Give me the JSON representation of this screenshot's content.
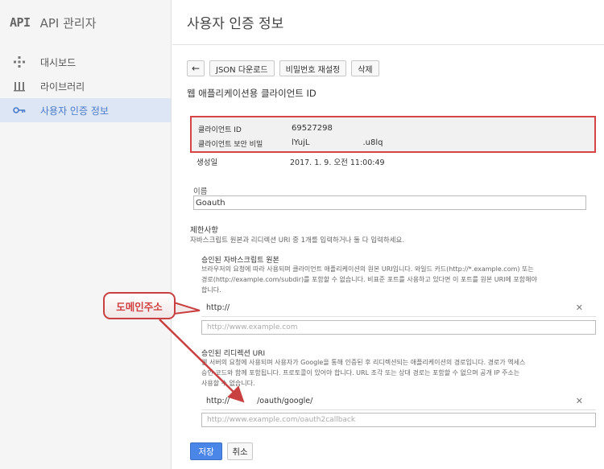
{
  "brand": {
    "logo": "API",
    "title": "API 관리자"
  },
  "sidebar": {
    "items": [
      {
        "label": "대시보드",
        "icon": "dashboard-icon"
      },
      {
        "label": "라이브러리",
        "icon": "library-icon"
      },
      {
        "label": "사용자 인증 정보",
        "icon": "key-icon"
      }
    ]
  },
  "header": {
    "title": "사용자 인증 정보"
  },
  "toolbar": {
    "back_label": "←",
    "download_label": "JSON 다운로드",
    "reset_label": "비밀번호 재설정",
    "delete_label": "삭제"
  },
  "section": {
    "title": "웹 애플리케이션용 클라이언트 ID"
  },
  "client": {
    "id_label": "클라이언트 ID",
    "id_value": "69527298",
    "secret_label": "클라이언트 보안 비밀",
    "secret_value_start": "lYujL",
    "secret_value_end": ".u8lq",
    "created_label": "생성일",
    "created_value": "2017. 1. 9. 오전 11:00:49"
  },
  "name_field": {
    "label": "이름",
    "value": "Goauth"
  },
  "restrictions": {
    "title": "제한사항",
    "desc": "자바스크립트 원본과 리디렉션 URI 중 1개를 입력하거나 둘 다 입력하세요.",
    "js_origins": {
      "title": "승인된 자바스크립트 원본",
      "desc_line1": "브라우저의 요청에 따라 사용되며 클라이언트 애플리케이션의 원본 URI입니다. 와일드 카드(http://*.example.com) 또는",
      "desc_line2": "경로(http://example.com/subdir)를 포함할 수 없습니다. 비표준 포트를 사용하고 있다면 이 포트를 원본 URI에 포함해야",
      "desc_line3": "합니다.",
      "entry": "http://",
      "placeholder": "http://www.example.com"
    },
    "redirect_uris": {
      "title": "승인된 리디렉션 URI",
      "desc_line1": "웹 서버의 요청에 사용되며 사용자가 Google을 통해 인증된 후 리디렉션되는 애플리케이션의 경로입니다. 경로가 액세스",
      "desc_line2": "승인 코드와 함께 포함됩니다. 프로토콜이 있어야 합니다. URL 조각 또는 상대 경로는 포함할 수 없으며 공개 IP 주소는",
      "desc_line3": "사용할 수 없습니다.",
      "entry_prefix": "http://",
      "entry_suffix": "/oauth/google/",
      "placeholder": "http://www.example.com/oauth2callback"
    }
  },
  "actions": {
    "save_label": "저장",
    "cancel_label": "취소"
  },
  "annotation": {
    "callout_text": "도메인주소"
  },
  "colors": {
    "accent": "#4a86e8",
    "highlight": "#d64545",
    "active_bg": "#dce6f5"
  }
}
